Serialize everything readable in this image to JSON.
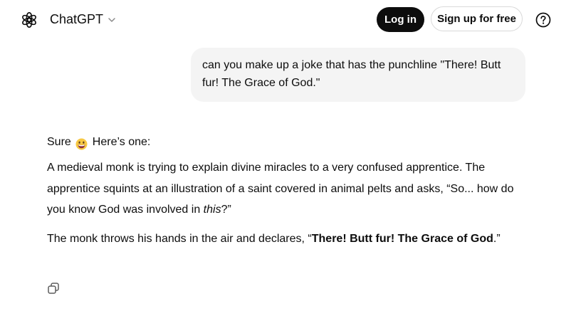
{
  "header": {
    "model_label": "ChatGPT",
    "login_label": "Log in",
    "signup_label": "Sign up for free"
  },
  "icons": {
    "logo": "openai-logo-icon",
    "model_dropdown": "chevron-down-icon",
    "help": "question-mark-icon",
    "emoji": "grinning-face-emoji",
    "copy": "copy-icon"
  },
  "conversation": {
    "user_message": "can you make up a joke that has the punchline \"There! Butt fur! The Grace of God.\"",
    "assistant": {
      "intro_before_emoji": "Sure",
      "intro_after_emoji": "Here’s one:",
      "para1_start": "A medieval monk is trying to explain divine miracles to a very confused apprentice. The apprentice squints at an illustration of a saint covered in animal pelts and asks, “So... how do you know God was involved in ",
      "para1_italic": "this",
      "para1_end": "?”",
      "para2_start": "The monk throws his hands in the air and declares, “",
      "para2_bold": "There! Butt fur! The Grace of God",
      "para2_end": ".”"
    }
  },
  "colors": {
    "text": "#0d0d0d",
    "login_bg": "#0d0d0d",
    "bubble_bg": "#f4f4f4",
    "border": "#d9d9d9"
  }
}
